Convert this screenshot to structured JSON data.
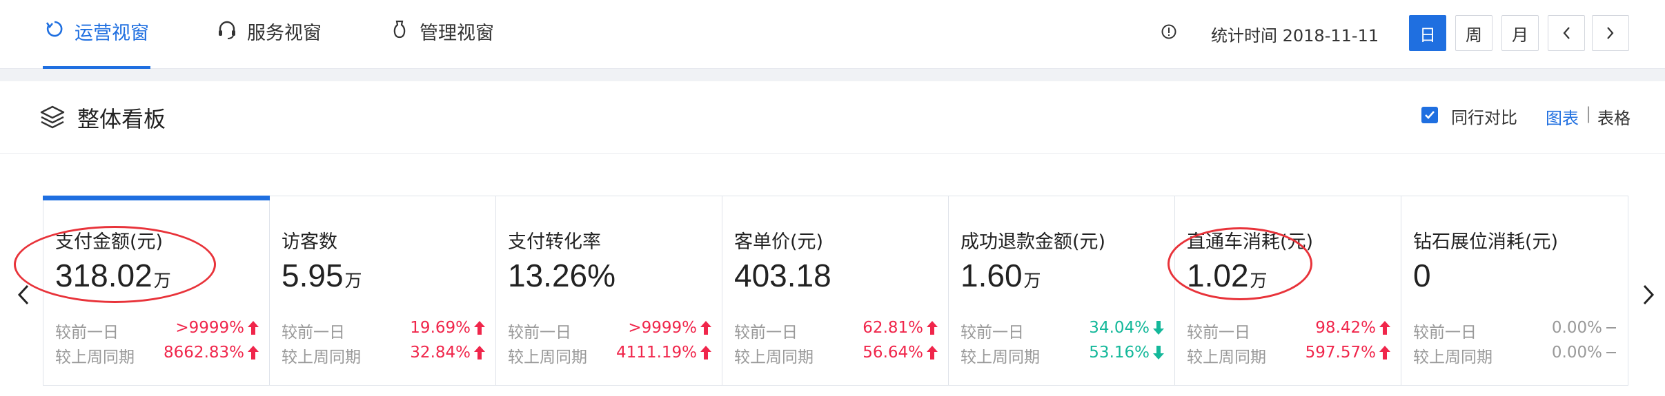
{
  "tabs": [
    {
      "label": "运营视窗",
      "icon": "monitor-refresh-icon",
      "active": true
    },
    {
      "label": "服务视窗",
      "icon": "headset-icon",
      "active": false
    },
    {
      "label": "管理视窗",
      "icon": "bulb-icon",
      "active": false
    }
  ],
  "header": {
    "stat_time": "统计时间 2018-11-11",
    "period_buttons": [
      "日",
      "周",
      "月"
    ],
    "active_period": "日"
  },
  "panel": {
    "title": "整体看板",
    "peer_compare_label": "同行对比",
    "peer_compare_checked": true,
    "view_chart": "图表",
    "view_sep": "|",
    "view_table": "表格"
  },
  "cards": [
    {
      "title": "支付金额(元)",
      "value": "318.02",
      "unit": "万",
      "day_label": "较前一日",
      "day_pct": ">9999%",
      "day_dir": "up",
      "week_label": "较上周同期",
      "week_pct": "8662.83%",
      "week_dir": "up",
      "active": true
    },
    {
      "title": "访客数",
      "value": "5.95",
      "unit": "万",
      "day_label": "较前一日",
      "day_pct": "19.69%",
      "day_dir": "up",
      "week_label": "较上周同期",
      "week_pct": "32.84%",
      "week_dir": "up"
    },
    {
      "title": "支付转化率",
      "value": "13.26%",
      "unit": "",
      "day_label": "较前一日",
      "day_pct": ">9999%",
      "day_dir": "up",
      "week_label": "较上周同期",
      "week_pct": "4111.19%",
      "week_dir": "up"
    },
    {
      "title": "客单价(元)",
      "value": "403.18",
      "unit": "",
      "day_label": "较前一日",
      "day_pct": "62.81%",
      "day_dir": "up",
      "week_label": "较上周同期",
      "week_pct": "56.64%",
      "week_dir": "up"
    },
    {
      "title": "成功退款金额(元)",
      "value": "1.60",
      "unit": "万",
      "day_label": "较前一日",
      "day_pct": "34.04%",
      "day_dir": "down",
      "week_label": "较上周同期",
      "week_pct": "53.16%",
      "week_dir": "down"
    },
    {
      "title": "直通车消耗(元)",
      "value": "1.02",
      "unit": "万",
      "day_label": "较前一日",
      "day_pct": "98.42%",
      "day_dir": "up",
      "week_label": "较上周同期",
      "week_pct": "597.57%",
      "week_dir": "up"
    },
    {
      "title": "钻石展位消耗(元)",
      "value": "0",
      "unit": "",
      "day_label": "较前一日",
      "day_pct": "0.00%",
      "day_dir": "flat",
      "week_label": "较上周同期",
      "week_pct": "0.00%",
      "week_dir": "flat"
    }
  ],
  "colors": {
    "accent": "#1f6fe0",
    "up": "#f0264b",
    "down": "#14b89a",
    "annotation": "#e8333a"
  }
}
